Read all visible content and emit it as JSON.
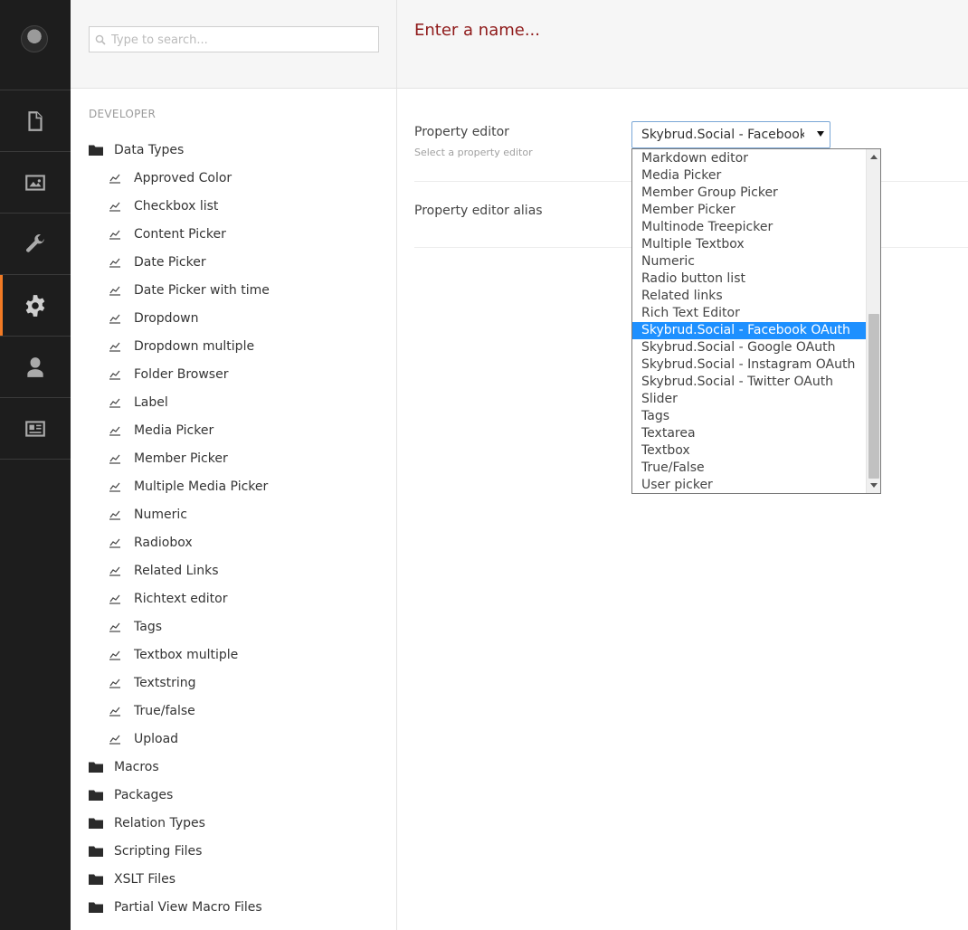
{
  "rail": {
    "items": [
      {
        "icon": "document-icon"
      },
      {
        "icon": "image-icon"
      },
      {
        "icon": "wrench-icon"
      },
      {
        "icon": "gear-icon",
        "active": true
      },
      {
        "icon": "user-icon"
      },
      {
        "icon": "id-card-icon"
      }
    ],
    "accent_color": "#f27a24"
  },
  "tree": {
    "search_placeholder": "Type to search...",
    "section_title": "DEVELOPER",
    "folders_top": [
      {
        "label": "Data Types"
      }
    ],
    "data_types": [
      "Approved Color",
      "Checkbox list",
      "Content Picker",
      "Date Picker",
      "Date Picker with time",
      "Dropdown",
      "Dropdown multiple",
      "Folder Browser",
      "Label",
      "Media Picker",
      "Member Picker",
      "Multiple Media Picker",
      "Numeric",
      "Radiobox",
      "Related Links",
      "Richtext editor",
      "Tags",
      "Textbox multiple",
      "Textstring",
      "True/false",
      "Upload"
    ],
    "folders_bottom": [
      "Macros",
      "Packages",
      "Relation Types",
      "Scripting Files",
      "XSLT Files",
      "Partial View Macro Files"
    ]
  },
  "main": {
    "name_placeholder": "Enter a name...",
    "name_color": "#8f1a1a",
    "property_editor": {
      "label": "Property editor",
      "description": "Select a property editor",
      "selected": "Skybrud.Social - Facebook OAuth",
      "options": [
        "Markdown editor",
        "Media Picker",
        "Member Group Picker",
        "Member Picker",
        "Multinode Treepicker",
        "Multiple Textbox",
        "Numeric",
        "Radio button list",
        "Related links",
        "Rich Text Editor",
        "Skybrud.Social - Facebook OAuth",
        "Skybrud.Social - Google OAuth",
        "Skybrud.Social - Instagram OAuth",
        "Skybrud.Social - Twitter OAuth",
        "Slider",
        "Tags",
        "Textarea",
        "Textbox",
        "True/False",
        "User picker"
      ],
      "highlight_color": "#1e90ff"
    },
    "property_editor_alias": {
      "label": "Property editor alias"
    }
  }
}
